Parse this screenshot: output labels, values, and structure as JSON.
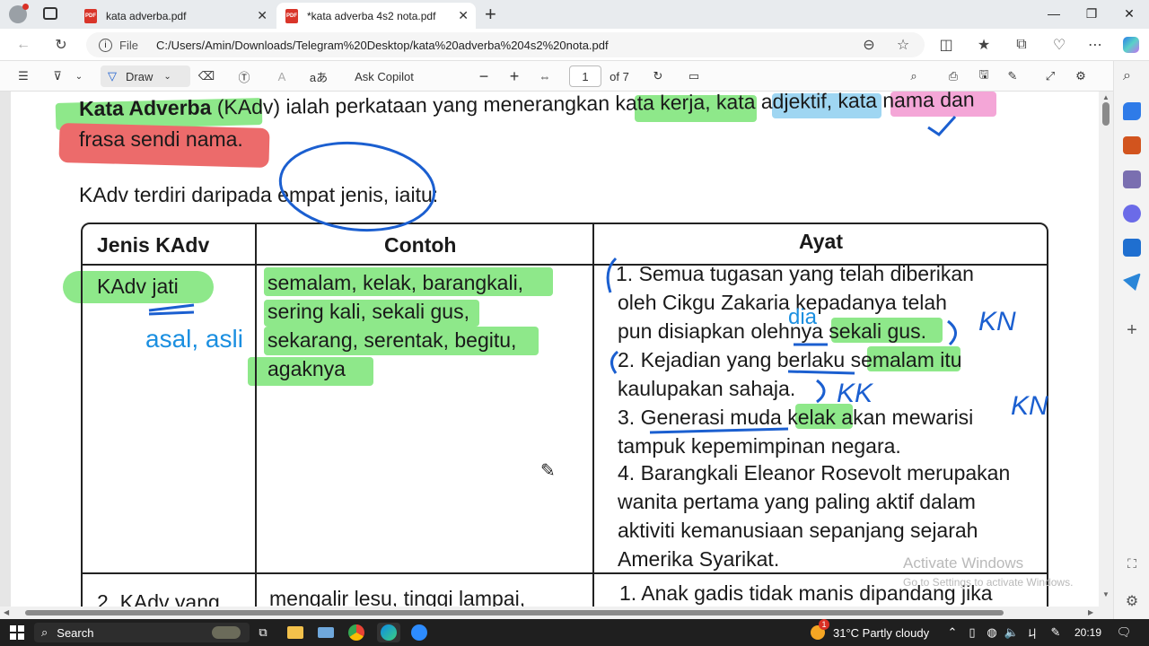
{
  "browser": {
    "tabs": [
      {
        "title": "kata adverba.pdf",
        "active": false
      },
      {
        "title": "*kata adverba 4s2 nota.pdf",
        "active": true
      }
    ],
    "new_tab_symbol": "+",
    "address": {
      "file_label": "File",
      "url": "C:/Users/Amin/Downloads/Telegram%20Desktop/kata%20adverba%204s2%20nota.pdf"
    }
  },
  "pdf_toolbar": {
    "draw_label": "Draw",
    "ask_copilot_label": "Ask Copilot",
    "read_aloud_glyph": "aあ",
    "page_number": "1",
    "page_total": "of 7"
  },
  "document": {
    "intro_line1_bold": "Kata Adverba",
    "intro_line1_rest": " (KAdv) ialah perkataan yang menerangkan kata kerja, kata adjektif, kata nama dan",
    "intro_line2": "frasa sendi nama.",
    "types_line": "KAdv terdiri daripada empat jenis, iaitu:",
    "table": {
      "headers": [
        "Jenis KAdv",
        "Contoh",
        "Ayat"
      ],
      "row1": {
        "type": "KAdv jati",
        "examples": [
          "semalam, kelak, barangkali,",
          "sering kali, sekali gus,",
          "sekarang,  serentak, begitu,",
          "agaknya"
        ],
        "sentences": [
          "1. Semua tugasan yang telah diberikan",
          "oleh Cikgu Zakaria kepadanya telah",
          "pun disiapkan olehnya sekali gus.",
          "2.  Kejadian yang berlaku semalam itu",
          "kaulupakan sahaja.",
          "3.  Generasi muda kelak akan mewarisi",
          "tampuk kepemimpinan negara.",
          "4.  Barangkali Eleanor Rosevolt merupakan",
          "wanita pertama yang paling aktif dalam",
          "aktiviti kemanusiaan sepanjang sejarah",
          "Amerika Syarikat."
        ]
      },
      "row2": {
        "type": "2. KAdv yang",
        "examples": "mengalir lesu, tinggi lampai,",
        "sentence": "1. Anak gadis tidak manis dipandang jika"
      }
    },
    "annotations": {
      "asal_asli": "asal, asli",
      "dia": "dia",
      "kn1": "KN",
      "kk": "KK",
      "kn2": "KN"
    }
  },
  "watermark": {
    "line1": "Activate Windows",
    "line2": "Go to Settings to activate Windows."
  },
  "taskbar": {
    "search_label": "Search",
    "weather": "31°C  Partly cloudy",
    "time": "20:19",
    "weather_badge": "1"
  },
  "colors": {
    "highlight_green": "#8ee88a",
    "highlight_red": "#ec6b6b",
    "highlight_blue": "#9fd6f2",
    "highlight_pink": "#f4a6d7",
    "ink_blue": "#1b5fd0",
    "pdf_icon_red": "#d9352a"
  }
}
